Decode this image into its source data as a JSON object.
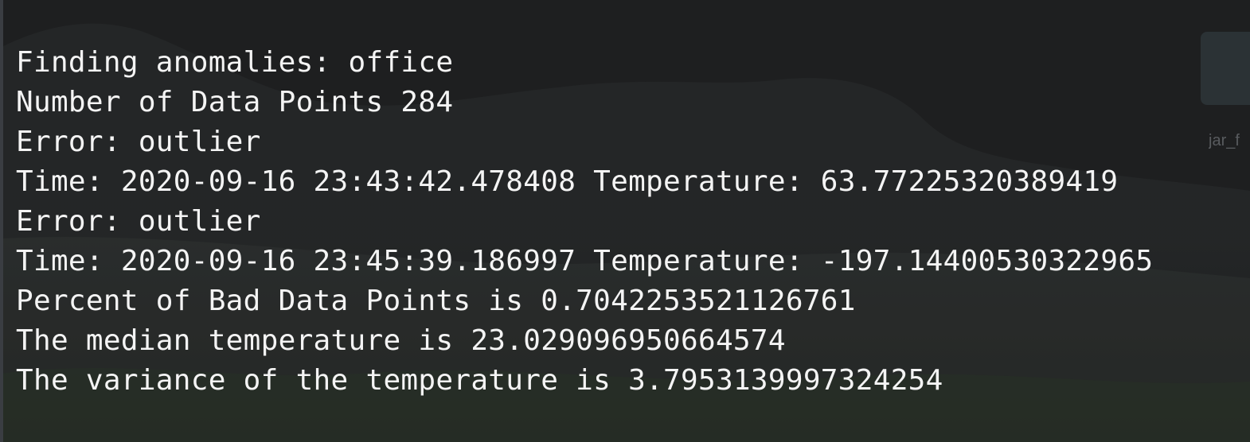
{
  "desktop": {
    "folder_label": "jar_f"
  },
  "terminal": {
    "lines": [
      "Finding anomalies: office",
      "Number of Data Points 284",
      "Error: outlier",
      "Time: 2020-09-16 23:43:42.478408 Temperature: 63.77225320389419",
      "Error: outlier",
      "Time: 2020-09-16 23:45:39.186997 Temperature: -197.14400530322965",
      "Percent of Bad Data Points is 0.7042253521126761",
      "The median temperature is 23.029096950664574",
      "The variance of the temperature is 3.7953139997324254"
    ],
    "colors": {
      "text": "#f4f4f4",
      "background": "#1e1f20"
    }
  }
}
